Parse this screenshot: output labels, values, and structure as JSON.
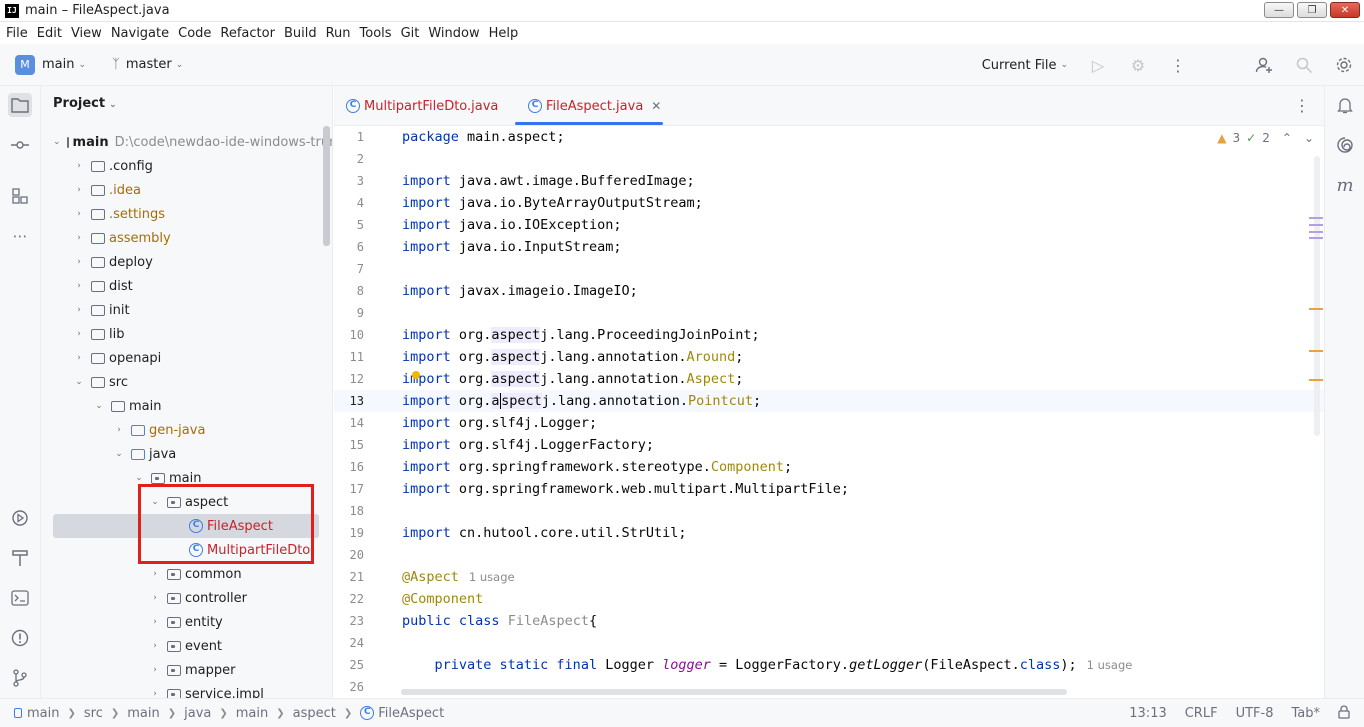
{
  "window": {
    "title": "main – FileAspect.java",
    "logo": "IJ",
    "controls": [
      "minimize",
      "maximize",
      "close"
    ]
  },
  "menu": [
    "File",
    "Edit",
    "View",
    "Navigate",
    "Code",
    "Refactor",
    "Build",
    "Run",
    "Tools",
    "Git",
    "Window",
    "Help"
  ],
  "toolbar": {
    "project_badge": "M",
    "project_name": "main",
    "branch": "master",
    "run_config": "Current File"
  },
  "project_panel": {
    "title": "Project",
    "root_name": "main",
    "root_path": "D:\\code\\newdao-ide-windows-trunk",
    "tree": [
      {
        "label": ".config",
        "type": "folder",
        "level": 1
      },
      {
        "label": ".idea",
        "type": "folder",
        "level": 1
      },
      {
        "label": ".settings",
        "type": "folder",
        "level": 1
      },
      {
        "label": "assembly",
        "type": "folder",
        "level": 1
      },
      {
        "label": "deploy",
        "type": "folder",
        "level": 1
      },
      {
        "label": "dist",
        "type": "folder",
        "level": 1
      },
      {
        "label": "init",
        "type": "folder",
        "level": 1
      },
      {
        "label": "lib",
        "type": "folder",
        "level": 1
      },
      {
        "label": "openapi",
        "type": "folder",
        "level": 1
      },
      {
        "label": "src",
        "type": "folder",
        "level": 1,
        "expanded": true
      },
      {
        "label": "main",
        "type": "folder",
        "level": 2,
        "expanded": true
      },
      {
        "label": "gen-java",
        "type": "src",
        "level": 3
      },
      {
        "label": "java",
        "type": "src",
        "level": 3,
        "expanded": true
      },
      {
        "label": "main",
        "type": "package",
        "level": 4,
        "expanded": true
      },
      {
        "label": "aspect",
        "type": "package",
        "level": 5,
        "expanded": true
      },
      {
        "label": "FileAspect",
        "type": "class",
        "level": 6,
        "selected": true
      },
      {
        "label": "MultipartFileDto",
        "type": "class",
        "level": 6
      },
      {
        "label": "common",
        "type": "package",
        "level": 5
      },
      {
        "label": "controller",
        "type": "package",
        "level": 5
      },
      {
        "label": "entity",
        "type": "package",
        "level": 5
      },
      {
        "label": "event",
        "type": "package",
        "level": 5
      },
      {
        "label": "mapper",
        "type": "package",
        "level": 5
      },
      {
        "label": "service.impl",
        "type": "package",
        "level": 5
      }
    ]
  },
  "tabs": [
    {
      "label": "MultipartFileDto.java",
      "active": false
    },
    {
      "label": "FileAspect.java",
      "active": true
    }
  ],
  "editor": {
    "warnings": "3",
    "checks": "2",
    "current_line": 13,
    "usage_label": "1 usage"
  },
  "statusbar": {
    "breadcrumbs": [
      "main",
      "src",
      "main",
      "java",
      "main",
      "aspect",
      "FileAspect"
    ],
    "position": "13:13",
    "line_ending": "CRLF",
    "encoding": "UTF-8",
    "indent": "Tab*"
  },
  "colors": {
    "accent": "#3574f0",
    "highlight_box": "#e0201b",
    "keyword": "#0033b3",
    "annotation": "#9e880d"
  }
}
